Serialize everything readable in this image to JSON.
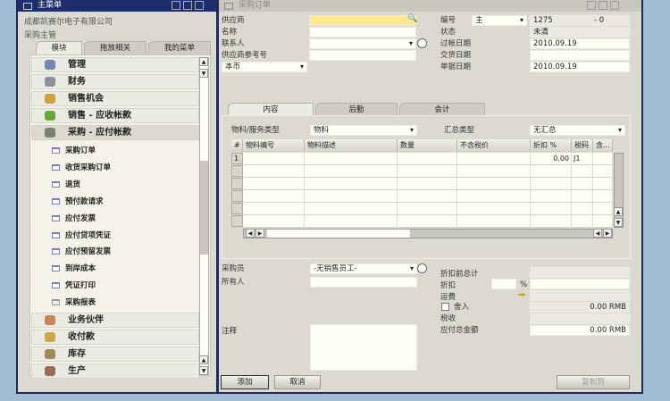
{
  "main_menu": {
    "title": "主菜单",
    "company": "成都凯赛尔电子有限公司",
    "user": "采购主管",
    "tabs": [
      "模块",
      "拖放相关",
      "我的菜单"
    ],
    "modules_top": [
      {
        "label": "管理",
        "icon": "admin-icon",
        "color": "#6f86b8"
      },
      {
        "label": "财务",
        "icon": "finance-icon",
        "color": "#8a8f9a"
      },
      {
        "label": "销售机会",
        "icon": "opportunity-icon",
        "color": "#d1a23a"
      },
      {
        "label": "销售 - 应收帐款",
        "icon": "sales-icon",
        "color": "#6aa83c"
      },
      {
        "label": "采购 - 应付帐款",
        "icon": "purchasing-icon",
        "color": "#7a7f6e"
      }
    ],
    "purchasing_items": [
      "采购订单",
      "收货采购订单",
      "退货",
      "预付款请求",
      "应付发票",
      "应付贷项凭证",
      "应付预留发票",
      "到岸成本",
      "凭证打印",
      "采购报表"
    ],
    "modules_bottom": [
      {
        "label": "业务伙伴",
        "icon": "business-partner-icon",
        "color": "#c9845a"
      },
      {
        "label": "收付款",
        "icon": "banking-icon",
        "color": "#c8a84a"
      },
      {
        "label": "库存",
        "icon": "inventory-icon",
        "color": "#a08a5a"
      },
      {
        "label": "生产",
        "icon": "production-icon",
        "color": "#9a6a5a"
      }
    ]
  },
  "po": {
    "title": "采购订单",
    "header_left": {
      "vendor_label": "供应商",
      "vendor_value": "",
      "name_label": "名称",
      "contact_label": "联系人",
      "vendor_ref_label": "供应商参考号",
      "currency": "本币"
    },
    "header_right": {
      "number_label": "编号",
      "series": "主",
      "number": "1275",
      "suffix": "- 0",
      "status_label": "状态",
      "status": "未清",
      "posting_label": "过帐日期",
      "posting": "2010.09.19",
      "delivery_label": "交货日期",
      "delivery": "",
      "doc_date_label": "单据日期",
      "doc_date": "2010.09.19"
    },
    "tabs": [
      "内容",
      "后勤",
      "会计"
    ],
    "item_type_label": "物料/服务类型",
    "item_type": "物料",
    "summary_label": "汇总类型",
    "summary": "无汇总",
    "grid": {
      "columns": [
        "#",
        "物料编号",
        "物料描述",
        "数量",
        "不含税价",
        "折扣 %",
        "税码",
        "含..."
      ],
      "rows": [
        [
          "1",
          "",
          "",
          "",
          "",
          "0.00",
          "J1",
          ""
        ]
      ]
    },
    "footer_left": {
      "buyer_label": "采购员",
      "buyer": "-无销售员工-",
      "owner_label": "所有人",
      "remarks_label": "注释"
    },
    "footer_right": {
      "before_discount_label": "折扣前总计",
      "discount_label": "折扣",
      "pct": "%",
      "freight_label": "运费",
      "rounding_label": "舍入",
      "rounding": "0.00 RMB",
      "tax_label": "税收",
      "total_label": "应付总金额",
      "total": "0.00 RMB"
    },
    "buttons": {
      "add": "添加",
      "cancel": "取消",
      "copy_to": "复制到"
    }
  }
}
